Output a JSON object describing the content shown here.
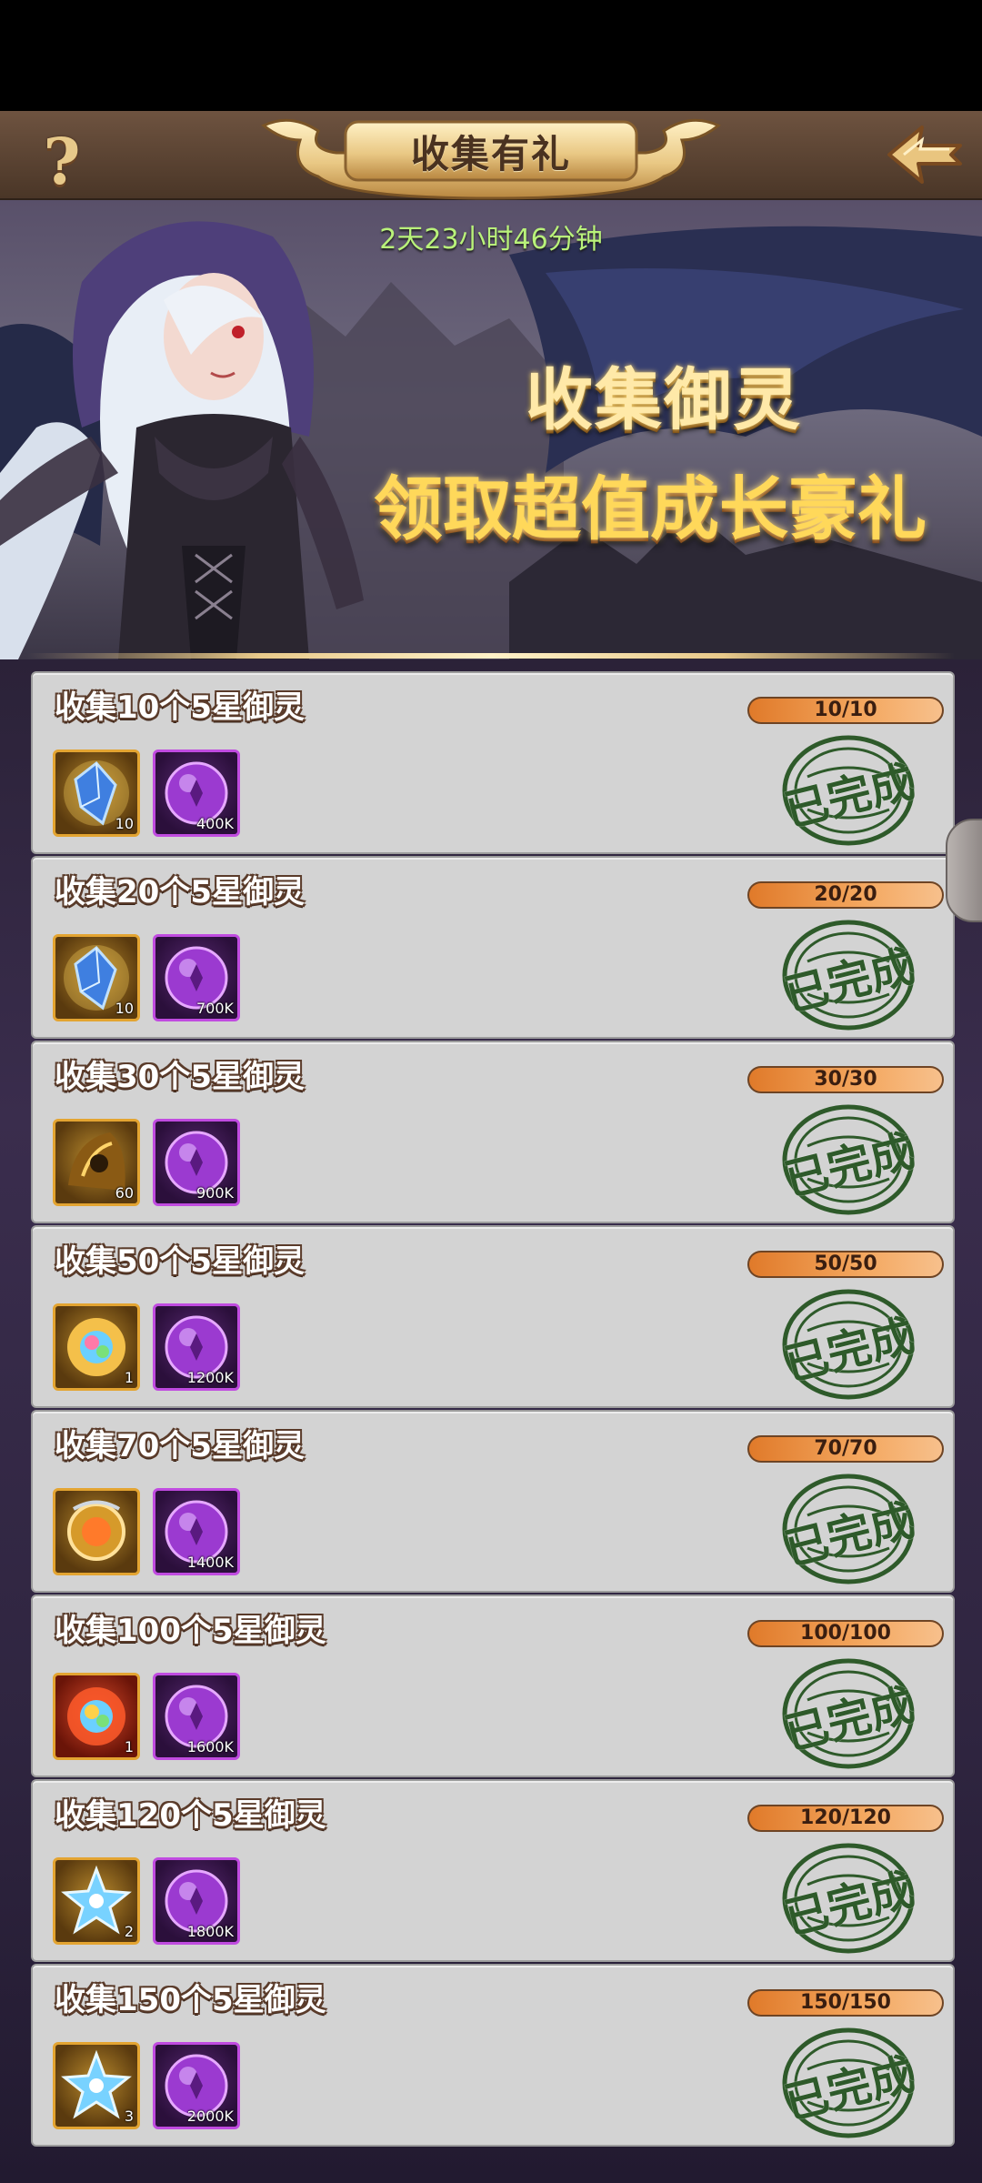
{
  "header": {
    "title": "收集有礼",
    "help_label": "?"
  },
  "banner": {
    "timer": "2天23小时46分钟",
    "line1": "收集御灵",
    "line2": "领取超值成长豪礼"
  },
  "colors": {
    "progress_fill": "#f4a860",
    "stamp_green": "#2e5a2a",
    "card_bg": "#d3d3d3",
    "timer_green": "#b9f27a"
  },
  "tasks": [
    {
      "title": "收集10个5星御灵",
      "progress_text": "10/10",
      "progress": 1.0,
      "status": "已完成",
      "rewards": [
        {
          "icon": "blue-crystal-icon",
          "qty": "10"
        },
        {
          "icon": "purple-orb-icon",
          "qty": "400K"
        }
      ]
    },
    {
      "title": "收集20个5星御灵",
      "progress_text": "20/20",
      "progress": 1.0,
      "status": "已完成",
      "rewards": [
        {
          "icon": "blue-crystal-icon",
          "qty": "10"
        },
        {
          "icon": "purple-orb-icon",
          "qty": "700K"
        }
      ]
    },
    {
      "title": "收集30个5星御灵",
      "progress_text": "30/30",
      "progress": 1.0,
      "status": "已完成",
      "rewards": [
        {
          "icon": "gold-shard-icon",
          "qty": "60"
        },
        {
          "icon": "purple-orb-icon",
          "qty": "900K"
        }
      ]
    },
    {
      "title": "收集50个5星御灵",
      "progress_text": "50/50",
      "progress": 1.0,
      "status": "已完成",
      "rewards": [
        {
          "icon": "rainbow-orb-icon",
          "qty": "1"
        },
        {
          "icon": "purple-orb-icon",
          "qty": "1200K"
        }
      ]
    },
    {
      "title": "收集70个5星御灵",
      "progress_text": "70/70",
      "progress": 1.0,
      "status": "已完成",
      "rewards": [
        {
          "icon": "golden-amulet-icon",
          "qty": ""
        },
        {
          "icon": "purple-orb-icon",
          "qty": "1400K"
        }
      ]
    },
    {
      "title": "收集100个5星御灵",
      "progress_text": "100/100",
      "progress": 1.0,
      "status": "已完成",
      "rewards": [
        {
          "icon": "red-rainbow-orb-icon",
          "qty": "1"
        },
        {
          "icon": "purple-orb-icon",
          "qty": "1600K"
        }
      ]
    },
    {
      "title": "收集120个5星御灵",
      "progress_text": "120/120",
      "progress": 1.0,
      "status": "已完成",
      "rewards": [
        {
          "icon": "ice-star-icon",
          "qty": "2"
        },
        {
          "icon": "purple-orb-icon",
          "qty": "1800K"
        }
      ]
    },
    {
      "title": "收集150个5星御灵",
      "progress_text": "150/150",
      "progress": 1.0,
      "status": "已完成",
      "rewards": [
        {
          "icon": "ice-star-icon",
          "qty": "3"
        },
        {
          "icon": "purple-orb-icon",
          "qty": "2000K"
        }
      ]
    }
  ]
}
